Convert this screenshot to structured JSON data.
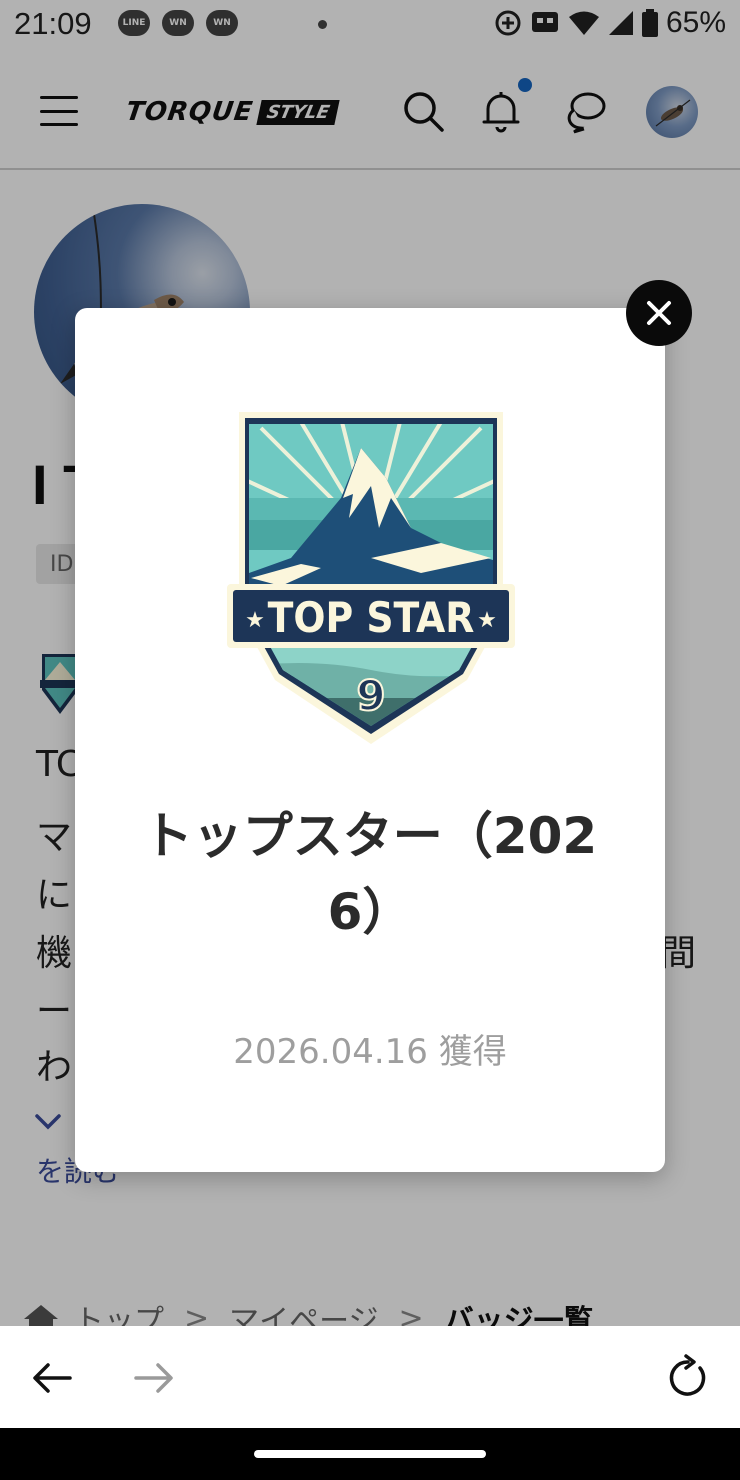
{
  "status_bar": {
    "time": "21:09",
    "left_icons": [
      "line-notification-icon",
      "wn-notification-icon",
      "wn-notification-icon"
    ],
    "line_label": "LINE",
    "wn_label": "WN",
    "right_icons": [
      "data-saver-icon",
      "cast-icon",
      "wifi-icon",
      "signal-icon",
      "battery-icon"
    ],
    "battery": "65%"
  },
  "header": {
    "logo_main": "TORQUE",
    "logo_badge": "STYLE",
    "icons": [
      "menu-icon",
      "search-icon",
      "bell-icon",
      "chat-icon",
      "avatar"
    ],
    "notification_dot_color": "#1565c0"
  },
  "profile": {
    "name_partial": "I T",
    "id_label": "ID",
    "bio_lines_visible": [
      "TC",
      "マ",
      "に",
      "機",
      "ー",
      "わ"
    ],
    "bio_right_fragment": "間",
    "read_more": "を読む"
  },
  "breadcrumb": {
    "items": [
      "トップ",
      "マイページ",
      "バッジ一覧"
    ],
    "separator": ">"
  },
  "modal": {
    "badge_name": "トップスター（2026）",
    "badge_art_text": "TOP STAR",
    "badge_art_number": "9",
    "acquired_date": "2026.04.16 獲得",
    "colors": {
      "navy": "#1d3557",
      "teal": "#5ec4c0",
      "cream": "#fbf6dc"
    }
  },
  "browser_nav": {
    "icons": [
      "back-arrow-icon",
      "forward-arrow-icon",
      "reload-icon"
    ]
  }
}
